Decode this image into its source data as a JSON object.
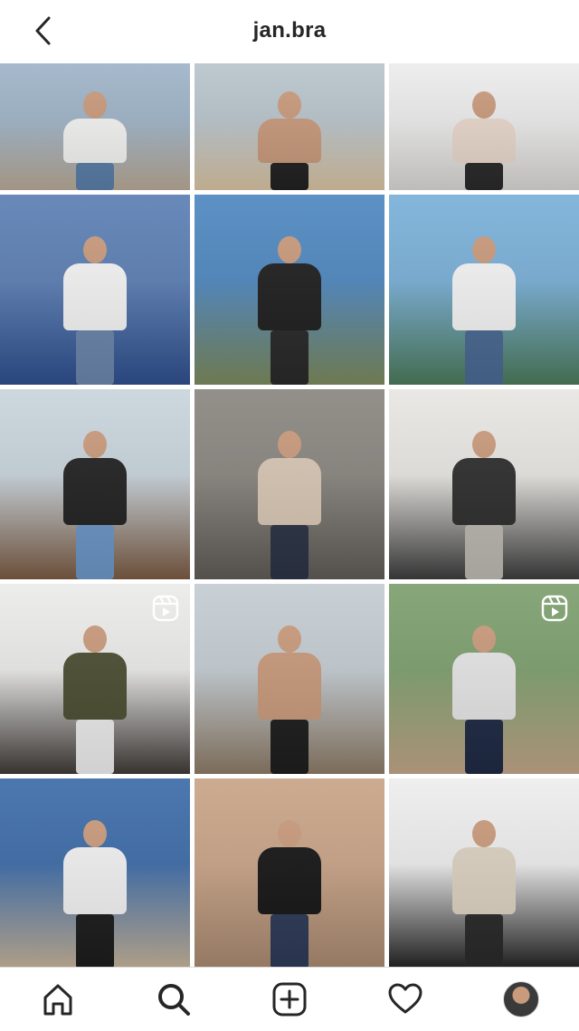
{
  "header": {
    "title": "jan.bra"
  },
  "icons": {
    "back": "chevron-left-icon",
    "reel": "reels-icon",
    "home": "home-icon",
    "search": "search-icon",
    "create": "plus-square-icon",
    "activity": "heart-icon",
    "profile": "avatar"
  },
  "grid": {
    "posts": [
      {
        "bg": [
          "#9fb4c8",
          "#b9a996"
        ],
        "shirt": "#f4f4f2",
        "pants": "#5a7fa8",
        "reel": false
      },
      {
        "bg": [
          "#b9c4cc",
          "#d9c3a1"
        ],
        "shirt": "#c99a7c",
        "pants": "#222222",
        "reel": false
      },
      {
        "bg": [
          "#ececec",
          "#d8d6d2"
        ],
        "shirt": "#e9d8cc",
        "pants": "#2a2a2a",
        "reel": false
      },
      {
        "bg": [
          "#5c7fb4",
          "#2f4f8e"
        ],
        "shirt": "#f5f5f5",
        "pants": "#6b86ac",
        "reel": false
      },
      {
        "bg": [
          "#4f88c0",
          "#7d8a5c"
        ],
        "shirt": "#1f1f1f",
        "pants": "#2a2a2a",
        "reel": false
      },
      {
        "bg": [
          "#7ab0d8",
          "#4c7a5a"
        ],
        "shirt": "#f5f5f5",
        "pants": "#4a6a93",
        "reel": false
      },
      {
        "bg": [
          "#c9d4dc",
          "#7a5a42"
        ],
        "shirt": "#222222",
        "pants": "#6d97c7",
        "reel": false
      },
      {
        "bg": [
          "#8a8680",
          "#5f5b56"
        ],
        "shirt": "#d8c7b5",
        "pants": "#2c3446",
        "reel": false
      },
      {
        "bg": [
          "#e8e6e2",
          "#3c3c3c"
        ],
        "shirt": "#2e2e2e",
        "pants": "#bdbab2",
        "reel": false
      },
      {
        "bg": [
          "#ebebea",
          "#3f3a36"
        ],
        "shirt": "#4b4e32",
        "pants": "#eeeeee",
        "reel": true
      },
      {
        "bg": [
          "#c4ccd2",
          "#8c7a66"
        ],
        "shirt": "#c99a7c",
        "pants": "#1e1e1e",
        "reel": false
      },
      {
        "bg": [
          "#7d9f6e",
          "#c2a588"
        ],
        "shirt": "#e6e6e6",
        "pants": "#1f2a44",
        "reel": true
      },
      {
        "bg": [
          "#3d6ca8",
          "#c7b49a"
        ],
        "shirt": "#f2f2f2",
        "pants": "#1d1d1d",
        "reel": false
      },
      {
        "bg": [
          "#c9a488",
          "#a8896f"
        ],
        "shirt": "#161616",
        "pants": "#2e3a58",
        "reel": false
      },
      {
        "bg": [
          "#ededed",
          "#222222"
        ],
        "shirt": "#dcd2c2",
        "pants": "#2a2a2a",
        "reel": false
      }
    ]
  }
}
